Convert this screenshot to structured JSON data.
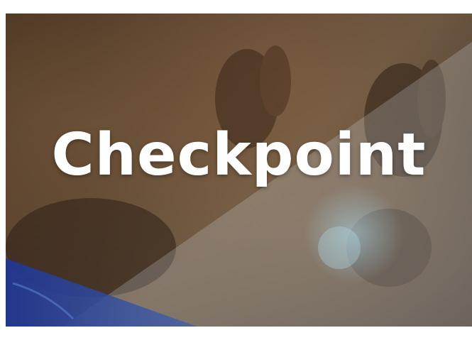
{
  "banner": {
    "title": "Checkpoint"
  },
  "colors": {
    "background": "#ffffff",
    "photo_tone": "#5b4330",
    "light_wedge": "#c8d6e2",
    "blue_corner": "#243a8c",
    "title_text": "#ffffff"
  },
  "scene": {
    "description_icon": "raised-hands-photo"
  }
}
